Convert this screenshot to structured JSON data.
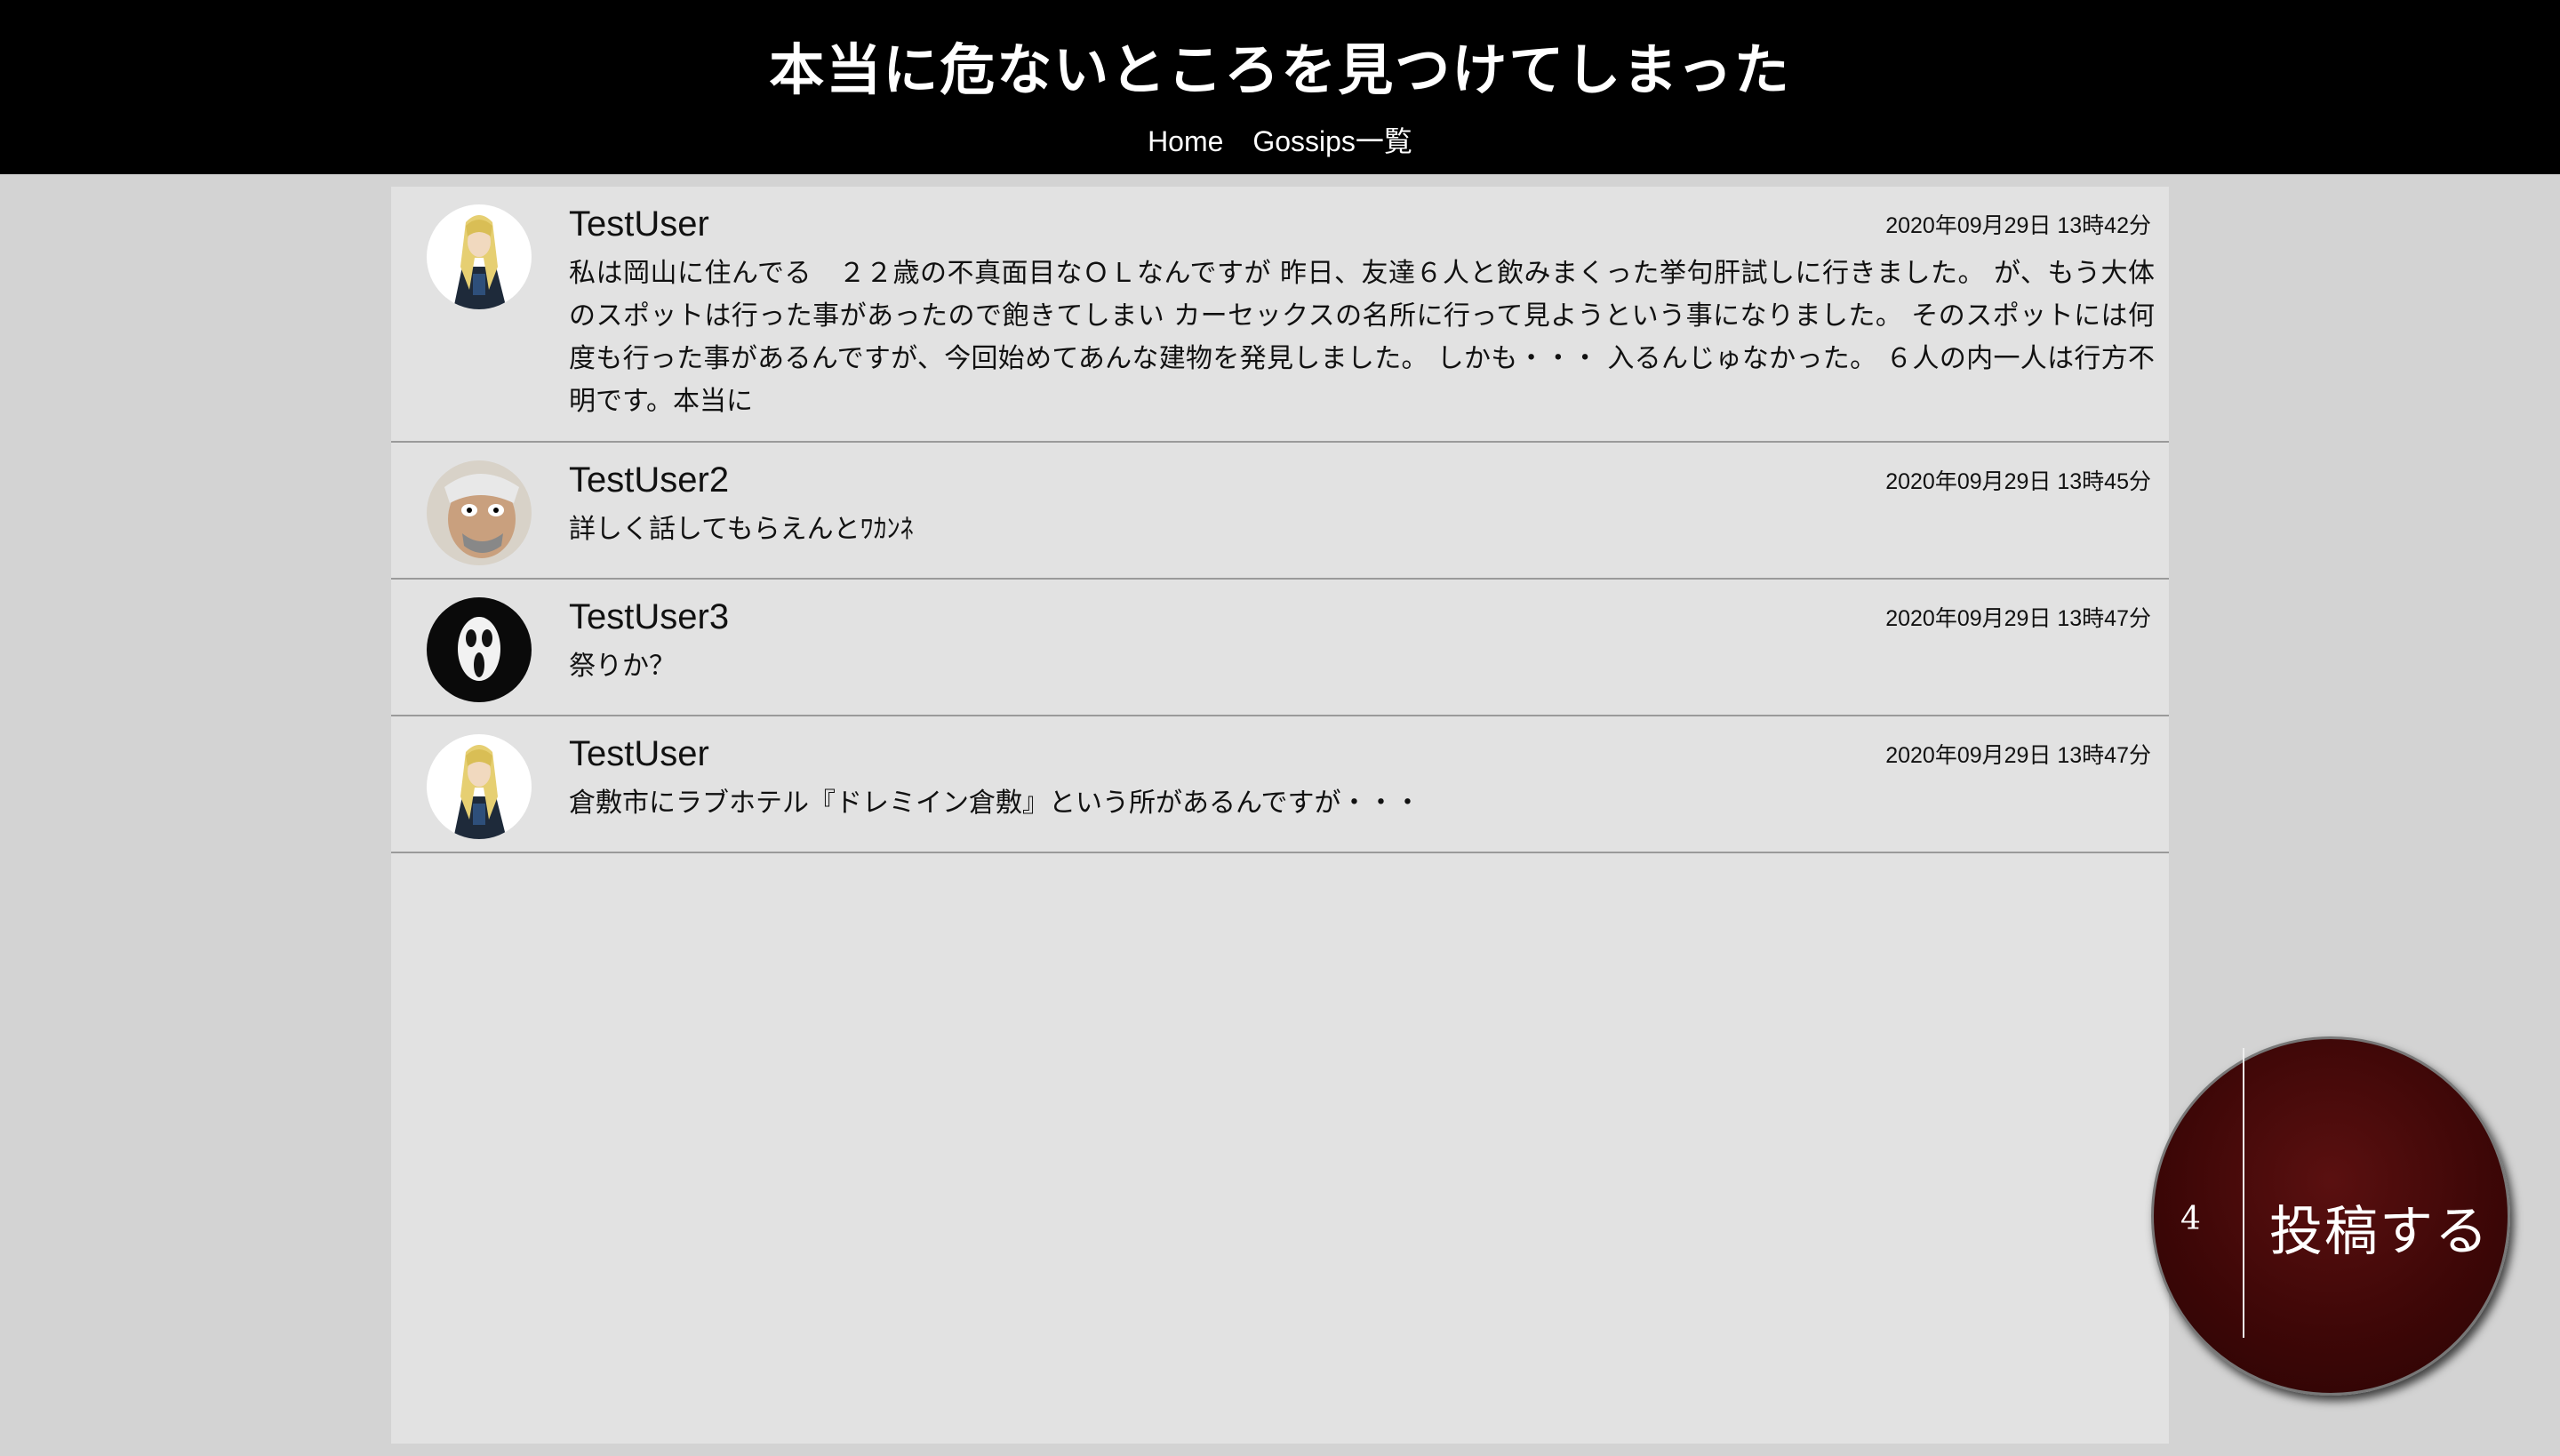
{
  "header": {
    "title": "本当に危ないところを見つけてしまった",
    "nav": [
      {
        "label": "Home"
      },
      {
        "label": "Gossips一覧"
      }
    ]
  },
  "posts": [
    {
      "user": "TestUser",
      "timestamp": "2020年09月29日 13時42分",
      "body": "私は岡山に住んでる　２２歳の不真面目なＯＬなんですが 昨日、友達６人と飲みまくった挙句肝試しに行きました。 が、もう大体のスポットは行った事があったので飽きてしまい カーセックスの名所に行って見ようという事になりました。 そのスポットには何度も行った事があるんですが、今回始めてあんな建物を発見しました。 しかも・・・ 入るんじゅなかった。 ６人の内一人は行方不明です。本当に",
      "avatar": "blonde-character-avatar"
    },
    {
      "user": "TestUser2",
      "timestamp": "2020年09月29日 13時45分",
      "body": "詳しく話してもらえんとﾜｶﾝﾈ",
      "avatar": "old-man-character-avatar"
    },
    {
      "user": "TestUser3",
      "timestamp": "2020年09月29日 13時47分",
      "body": "祭りか？",
      "avatar": "ghost-mask-avatar"
    },
    {
      "user": "TestUser",
      "timestamp": "2020年09月29日 13時47分",
      "body": "倉敷市にラブホテル『ドレミイン倉敷』という所があるんですが・・・",
      "avatar": "blonde-character-avatar"
    }
  ],
  "fab": {
    "count": "4",
    "label": "投稿する"
  },
  "colors": {
    "header_bg": "#000000",
    "page_bg": "#d3d3d3",
    "panel_bg": "#e2e2e2",
    "fab_bg": "#4a0b0b"
  }
}
